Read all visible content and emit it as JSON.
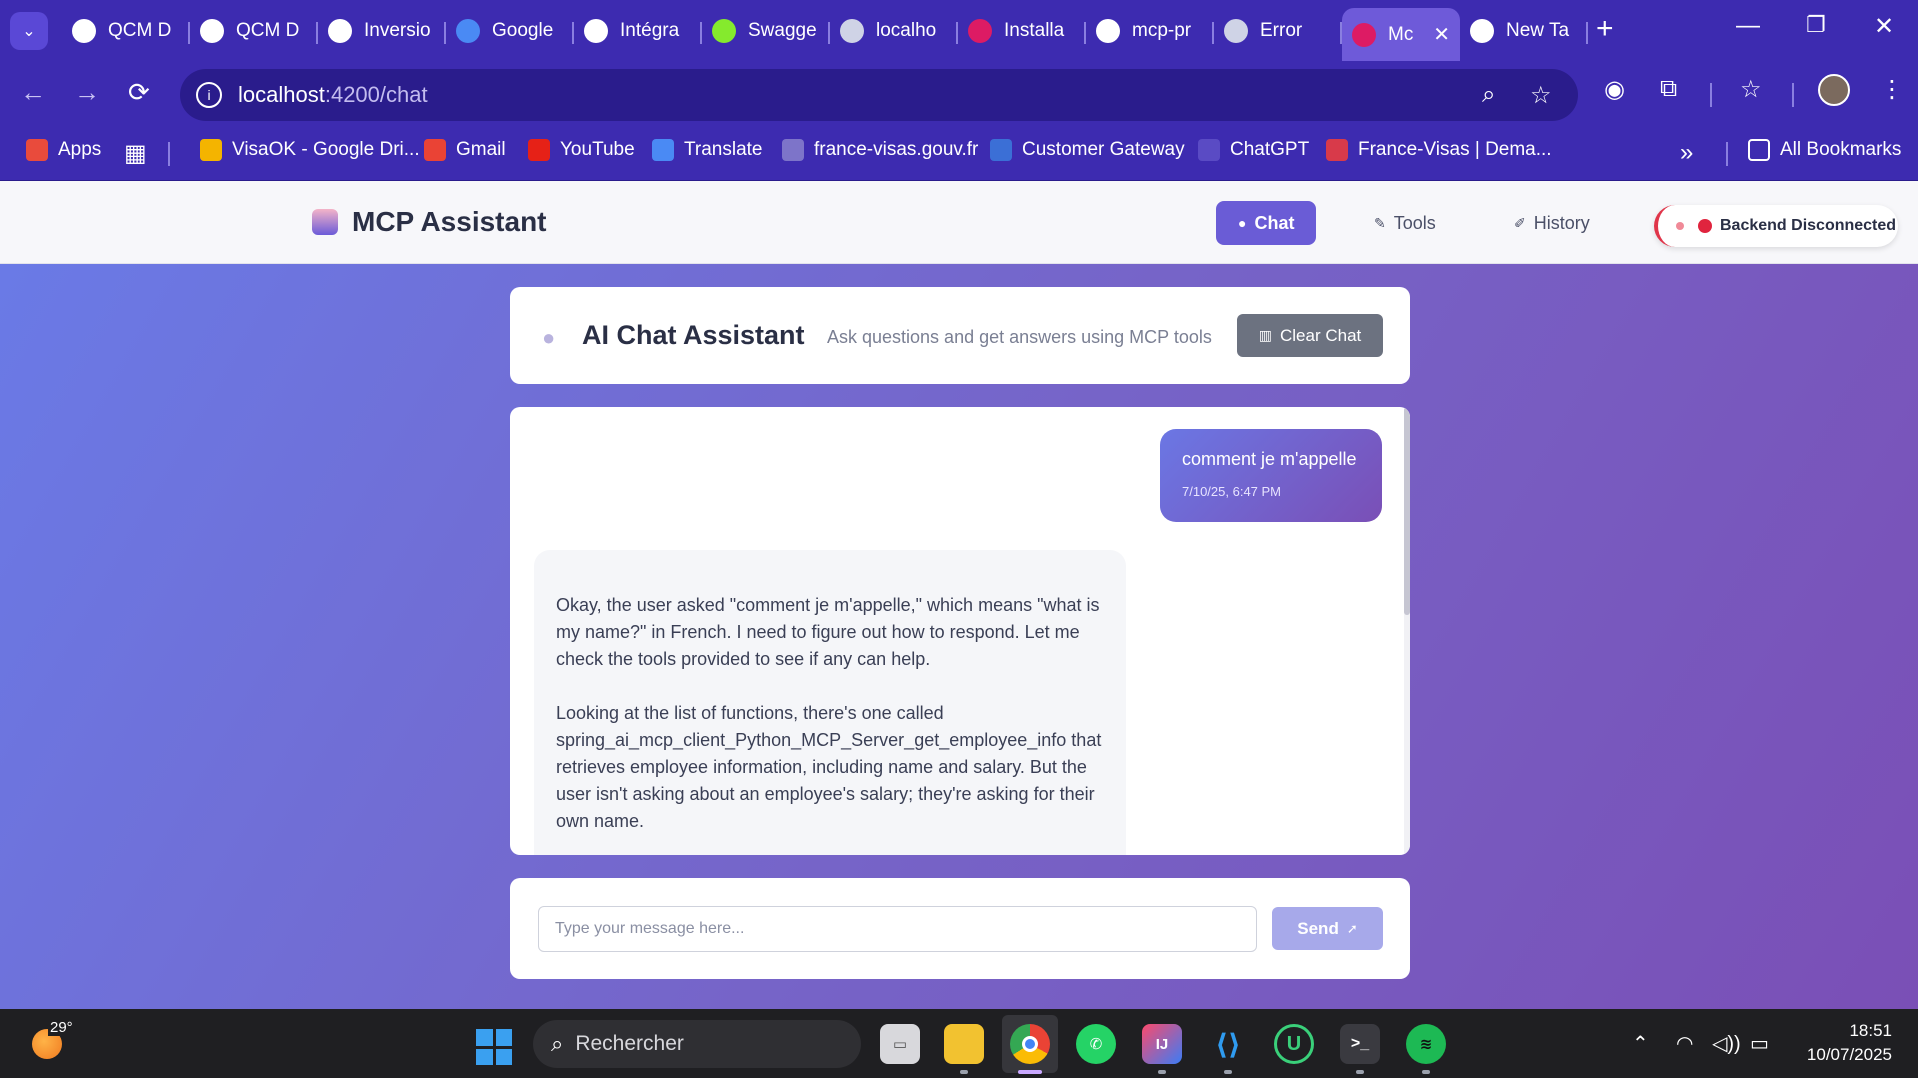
{
  "browser": {
    "tabs": [
      {
        "label": "QCM D",
        "icon": "openai-icon"
      },
      {
        "label": "QCM D",
        "icon": "openai-icon"
      },
      {
        "label": "Inversio",
        "icon": "perplexity-icon"
      },
      {
        "label": "Google",
        "icon": "google-translate-icon"
      },
      {
        "label": "Intégra",
        "icon": "openai-icon"
      },
      {
        "label": "Swagge",
        "icon": "swagger-icon"
      },
      {
        "label": "localho",
        "icon": "globe-icon"
      },
      {
        "label": "Installa",
        "icon": "angular-icon"
      },
      {
        "label": "mcp-pr",
        "icon": "github-icon"
      },
      {
        "label": "Error",
        "icon": "globe-icon"
      },
      {
        "label": "Mc",
        "icon": "angular-icon",
        "active": true
      },
      {
        "label": "New Ta",
        "icon": "chrome-icon"
      }
    ],
    "address": {
      "host": "localhost",
      "path": ":4200/chat"
    },
    "bookmarks": [
      {
        "label": "Apps",
        "icon": "apps-grid-icon"
      },
      {
        "label": "VisaOK - Google Dri...",
        "icon": "google-drive-icon"
      },
      {
        "label": "Gmail",
        "icon": "gmail-icon"
      },
      {
        "label": "YouTube",
        "icon": "youtube-icon"
      },
      {
        "label": "Translate",
        "icon": "google-translate-icon"
      },
      {
        "label": "france-visas.gouv.fr",
        "icon": "globe-icon"
      },
      {
        "label": "Customer Gateway",
        "icon": "aws-icon"
      },
      {
        "label": "ChatGPT",
        "icon": "openai-icon"
      },
      {
        "label": "France-Visas | Dema...",
        "icon": "france-visas-icon"
      },
      {
        "label": "All Bookmarks",
        "icon": "folder-icon"
      }
    ]
  },
  "app": {
    "title": "MCP Assistant",
    "nav": [
      {
        "label": "Chat",
        "icon": "chat-bubble-icon",
        "active": true
      },
      {
        "label": "Tools",
        "icon": "wrench-icon"
      },
      {
        "label": "History",
        "icon": "memo-icon"
      }
    ],
    "status": {
      "label": "Backend Disconnected",
      "color": "#e0243e"
    }
  },
  "chat": {
    "title": "AI Chat Assistant",
    "subtitle": "Ask questions and get answers using MCP tools",
    "clear_label": "Clear Chat",
    "messages": [
      {
        "role": "user",
        "text": "comment je m'appelle",
        "time": "7/10/25, 6:47 PM"
      },
      {
        "role": "assistant",
        "paragraphs": [
          "Okay, the user asked \"comment je m'appelle,\" which means \"what is my name?\" in French. I need to figure out how to respond. Let me check the tools provided to see if any can help.",
          "Looking at the list of functions, there's one called spring_ai_mcp_client_Python_MCP_Server_get_employee_info that retrieves employee information, including name and salary. But the user isn't asking about an employee's salary; they're asking for their own name."
        ]
      }
    ],
    "input_placeholder": "Type your message here...",
    "send_label": "Send"
  },
  "taskbar": {
    "temperature": "29°",
    "search_label": "Rechercher",
    "time": "18:51",
    "date": "10/07/2025"
  },
  "colors": {
    "browser_frame": "#3d2bb0",
    "accent": "#6a5cd6",
    "status_red": "#e0243e"
  }
}
